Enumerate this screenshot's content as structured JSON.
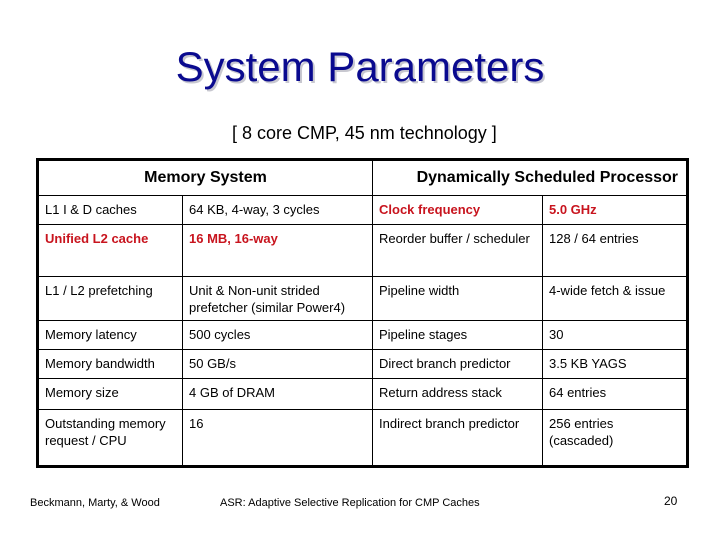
{
  "slide": {
    "title": "System Parameters",
    "subtitle": "[ 8 core CMP, 45 nm technology ]"
  },
  "table": {
    "headers": [
      "Memory System",
      "Dynamically Scheduled Processor"
    ],
    "highlight_color": "#c8141e",
    "rows": [
      {
        "mem_param": "L1 I & D caches",
        "mem_value": "64 KB, 4-way, 3 cycles",
        "mem_highlight": false,
        "proc_param": "Clock frequency",
        "proc_value": "5.0 GHz",
        "proc_highlight": true
      },
      {
        "mem_param": "Unified L2 cache",
        "mem_value": "16 MB, 16-way",
        "mem_highlight": true,
        "proc_param": "Reorder buffer / scheduler",
        "proc_value": "128 / 64 entries",
        "proc_highlight": false
      },
      {
        "mem_param": "L1 / L2 prefetching",
        "mem_value": "Unit & Non-unit strided prefetcher (similar Power4)",
        "mem_highlight": false,
        "proc_param": "Pipeline width",
        "proc_value": "4-wide fetch & issue",
        "proc_highlight": false
      },
      {
        "mem_param": "Memory latency",
        "mem_value": "500 cycles",
        "mem_highlight": false,
        "proc_param": "Pipeline stages",
        "proc_value": "30",
        "proc_highlight": false
      },
      {
        "mem_param": "Memory bandwidth",
        "mem_value": "50 GB/s",
        "mem_highlight": false,
        "proc_param": "Direct branch predictor",
        "proc_value": "3.5 KB YAGS",
        "proc_highlight": false
      },
      {
        "mem_param": "Memory size",
        "mem_value": "4 GB of DRAM",
        "mem_highlight": false,
        "proc_param": "Return address stack",
        "proc_value": "64 entries",
        "proc_highlight": false
      },
      {
        "mem_param": "Outstanding memory request / CPU",
        "mem_value": "16",
        "mem_highlight": false,
        "proc_param": "Indirect branch predictor",
        "proc_value": "256 entries (cascaded)",
        "proc_highlight": false
      }
    ]
  },
  "footer": {
    "authors": "Beckmann, Marty, & Wood",
    "paper_title": "ASR: Adaptive Selective Replication for CMP Caches",
    "page_number": "20"
  }
}
